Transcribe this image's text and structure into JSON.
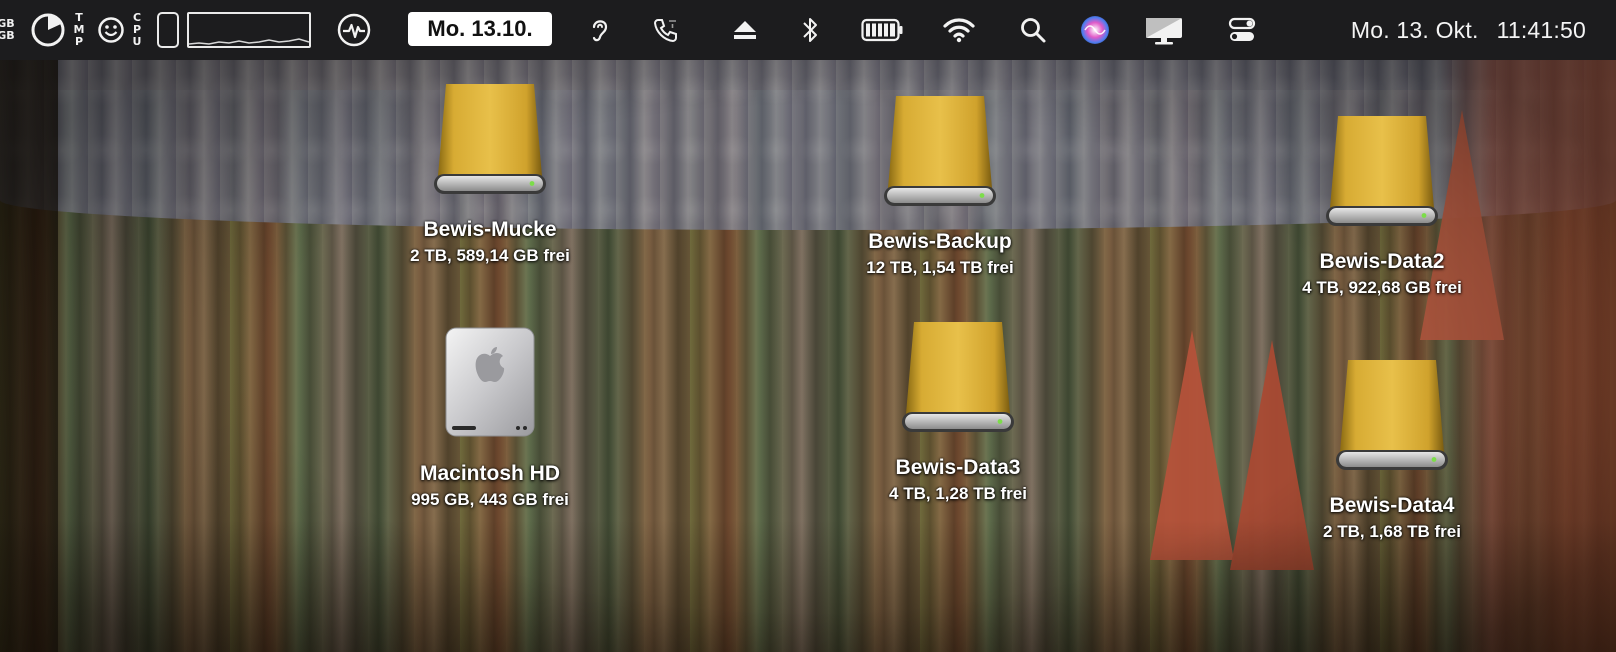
{
  "menubar": {
    "memory_stack": [
      "GB",
      "GB"
    ],
    "temp_stack": [
      "T",
      "M",
      "P"
    ],
    "cpu_stack": [
      "C",
      "P",
      "U"
    ],
    "date_badge": "Mo. 13.10.",
    "clock_date": "Mo. 13. Okt.",
    "clock_time": "11:41:50",
    "icons": [
      "disk-usage-pie-icon",
      "smiley-icon",
      "phone-outline-icon",
      "cpu-graph",
      "activity-monitor-icon",
      "hearing-icon",
      "phone-call-icon",
      "eject-icon",
      "bluetooth-icon",
      "battery-icon",
      "wifi-icon",
      "spotlight-search-icon",
      "siri-icon",
      "display-icon",
      "control-center-icon"
    ]
  },
  "desktop": {
    "drives": [
      {
        "name": "Bewis-Mucke",
        "info": "2 TB, 589,14 GB frei",
        "type": "external"
      },
      {
        "name": "Macintosh HD",
        "info": "995 GB, 443 GB frei",
        "type": "internal"
      },
      {
        "name": "Bewis-Backup",
        "info": "12 TB, 1,54 TB frei",
        "type": "external"
      },
      {
        "name": "Bewis-Data3",
        "info": "4 TB, 1,28 TB frei",
        "type": "external"
      },
      {
        "name": "Bewis-Data2",
        "info": "4 TB, 922,68 GB frei",
        "type": "external"
      },
      {
        "name": "Bewis-Data4",
        "info": "2 TB, 1,68 TB frei",
        "type": "external"
      }
    ]
  },
  "colors": {
    "menubar_bg": "#1c1c1e",
    "drive_gold": "#d4a52a",
    "label_text": "#ffffff"
  }
}
